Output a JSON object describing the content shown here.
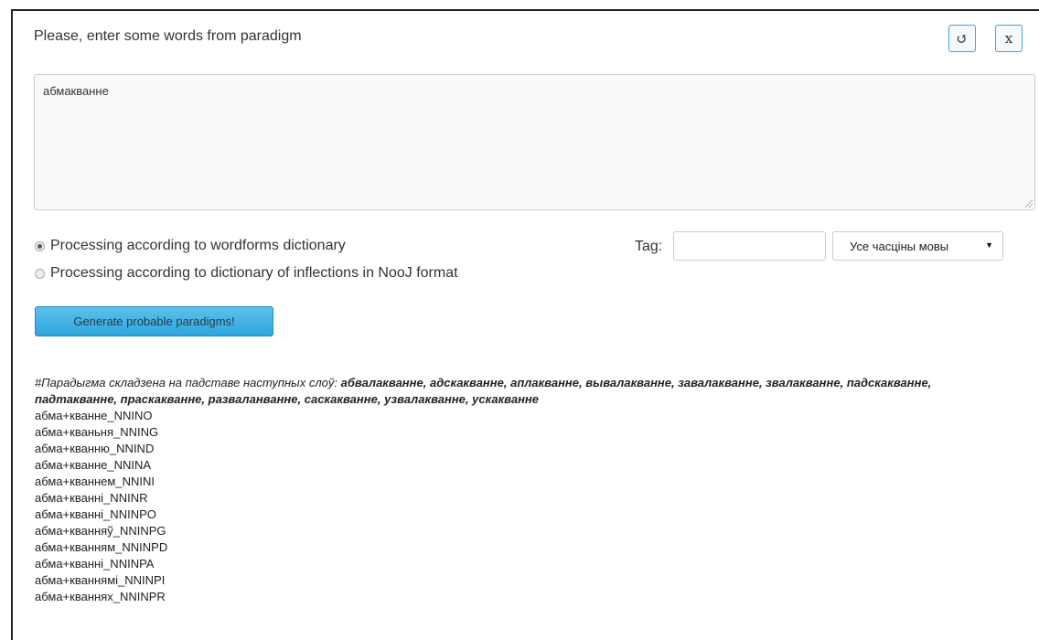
{
  "header": {
    "title": "Please, enter some words from paradigm",
    "reset_icon": "↺",
    "close_icon": "x"
  },
  "input": {
    "value": "абмакванне"
  },
  "options": {
    "radio_wordforms": "Processing according to wordforms dictionary",
    "radio_nooj": "Processing according to dictionary of inflections in NooJ format",
    "selected": "wordforms",
    "tag_label": "Tag:",
    "tag_value": "",
    "pos_select": "Усе часціны мовы"
  },
  "generate_button": "Generate probable paradigms!",
  "results": {
    "basis_intro": "#Парадыгма складзена на падставе наступных слоў: ",
    "basis_words": "абвалакванне, адскакванне, аплакванне, вывалакванне, завалакванне, звалакванне, падскакванне, падтакванне, праскакванне, разваланванне, саскакванне, узвалакванне, ускакванне",
    "forms": [
      "абма+кванне_NNINO",
      "абма+кваньня_NNING",
      "абма+кванню_NNIND",
      "абма+кванне_NNINA",
      "абма+кваннем_NNINI",
      "абма+кванні_NNINR",
      "абма+кванні_NNINPO",
      "абма+кванняў_NNINPG",
      "абма+кванням_NNINPD",
      "абма+кванні_NNINPA",
      "абма+кваннямі_NNINPI",
      "абма+кваннях_NNINPR"
    ]
  }
}
